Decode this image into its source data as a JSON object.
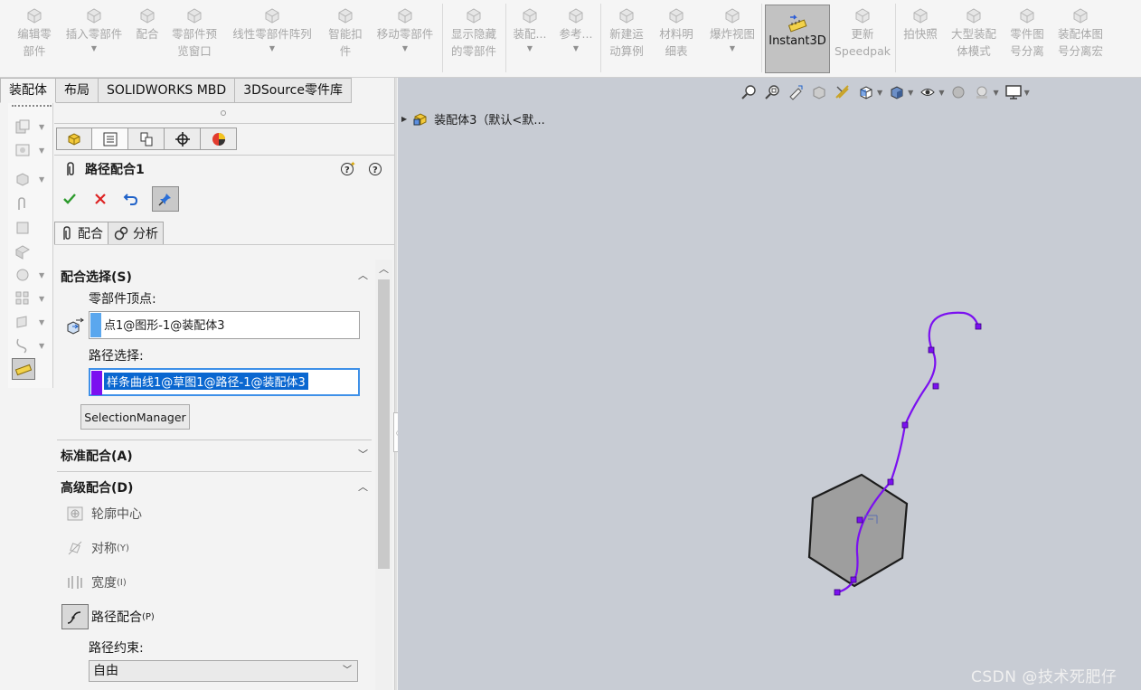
{
  "ribbon": {
    "buttons": [
      {
        "name": "edit-component-button",
        "label": "编辑零\n部件",
        "icon": "edit-component-icon",
        "arrow": false
      },
      {
        "name": "insert-components-button",
        "label": "插入零部件",
        "icon": "insert-components-icon",
        "arrow": true
      },
      {
        "name": "mate-button",
        "label": "配合",
        "icon": "mate-paperclip-icon",
        "arrow": false
      },
      {
        "name": "component-preview-button",
        "label": "零部件预\n览窗口",
        "icon": "preview-window-icon",
        "arrow": false
      },
      {
        "name": "linear-pattern-button",
        "label": "线性零部件阵列",
        "icon": "linear-pattern-icon",
        "arrow": true
      },
      {
        "name": "smart-fasteners-button",
        "label": "智能扣\n件",
        "icon": "smart-fasteners-icon",
        "arrow": false
      },
      {
        "name": "move-component-button",
        "label": "移动零部件",
        "icon": "move-component-icon",
        "arrow": true
      },
      {
        "name": "show-hidden-button",
        "label": "显示隐藏\n的零部件",
        "icon": "show-hidden-icon",
        "arrow": false
      },
      {
        "name": "assembly-features-button",
        "label": "装配...",
        "icon": "assembly-features-icon",
        "arrow": true
      },
      {
        "name": "reference-geometry-button",
        "label": "参考...",
        "icon": "reference-geometry-icon",
        "arrow": true
      },
      {
        "name": "new-motion-study-button",
        "label": "新建运\n动算例",
        "icon": "motion-study-icon",
        "arrow": false
      },
      {
        "name": "bill-of-materials-button",
        "label": "材料明\n细表",
        "icon": "bom-icon",
        "arrow": false
      },
      {
        "name": "exploded-view-button",
        "label": "爆炸视图",
        "icon": "exploded-view-icon",
        "arrow": true
      },
      {
        "name": "update-speedpak-button",
        "label": "更新\nSpeedpak",
        "icon": "speedpak-icon",
        "arrow": false
      },
      {
        "name": "take-snapshot-button",
        "label": "拍快照",
        "icon": "camera-icon",
        "arrow": false
      },
      {
        "name": "large-assembly-mode-button",
        "label": "大型装配\n体模式",
        "icon": "large-assembly-icon",
        "arrow": false
      },
      {
        "name": "part-drawing-separate-button",
        "label": "零件图\n号分离",
        "icon": "part-number-icon",
        "arrow": false
      },
      {
        "name": "assembly-drawing-separate-button",
        "label": "装配体图\n号分离宏",
        "icon": "assembly-number-icon",
        "arrow": false
      }
    ],
    "instant3d_label": "Instant3D"
  },
  "tabs": [
    "装配体",
    "布局",
    "SOLIDWORKS MBD",
    "3DSource零件库"
  ],
  "pm": {
    "title": "路径配合1",
    "subtabs": [
      "配合",
      "分析"
    ],
    "mate_selections": {
      "heading": "配合选择(S)",
      "vertex_label": "零部件顶点:",
      "vertex_value": "点1@图形-1@装配体3",
      "vertex_color": "#5aa7ee",
      "path_label": "路径选择:",
      "path_value": "样条曲线1@草图1@路径-1@装配体3",
      "path_color": "#7b10f0",
      "selection_manager": "SelectionManager"
    },
    "standard_heading": "标准配合(A)",
    "advanced": {
      "heading": "高级配合(D)",
      "items": [
        {
          "label": "轮廓中心",
          "hint": ""
        },
        {
          "label": "对称",
          "hint": "(Y)"
        },
        {
          "label": "宽度",
          "hint": "(I)"
        },
        {
          "label": "路径配合",
          "hint": "(P)"
        }
      ],
      "path_constraint_label": "路径约束:",
      "path_constraint_value": "自由"
    }
  },
  "viewport": {
    "tree_node": "装配体3（默认<默...",
    "watermark": "CSDN @技术死肥仔",
    "spline_color": "#7b10f0"
  }
}
